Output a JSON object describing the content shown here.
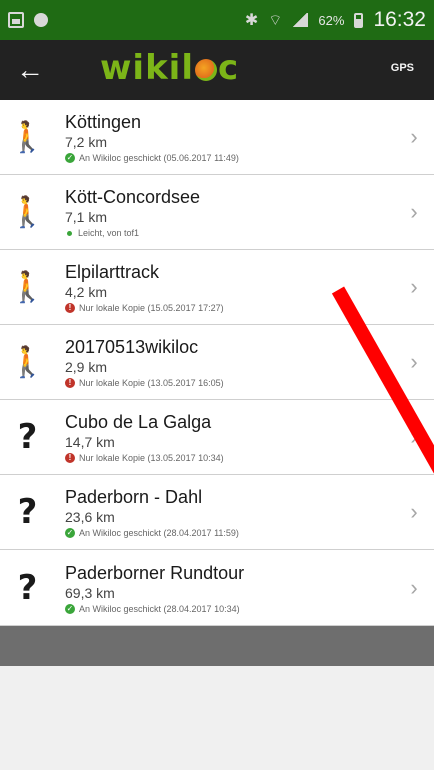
{
  "status_bar": {
    "time": "16:32",
    "battery": "62%"
  },
  "app_bar": {
    "logo": "wikiloc",
    "gps_label": "GPS"
  },
  "tracks": [
    {
      "title": "Köttingen",
      "distance": "7,2 km",
      "status": "An Wikiloc geschickt (05.06.2017 11:49)",
      "status_type": "sent",
      "icon": "hiker-icon"
    },
    {
      "title": "Kött-Concordsee",
      "distance": "7,1 km",
      "status": "Leicht, von tof1",
      "status_type": "info",
      "icon": "hiker-icon"
    },
    {
      "title": "Elpilarttrack",
      "distance": "4,2 km",
      "status": "Nur lokale Kopie (15.05.2017 17:27)",
      "status_type": "local",
      "icon": "hiker-icon"
    },
    {
      "title": "20170513wikiloc",
      "distance": "2,9 km",
      "status": "Nur lokale Kopie (13.05.2017 16:05)",
      "status_type": "local",
      "icon": "hiker-icon"
    },
    {
      "title": "Cubo de La Galga",
      "distance": "14,7 km",
      "status": "Nur lokale Kopie (13.05.2017 10:34)",
      "status_type": "local",
      "icon": "question-icon"
    },
    {
      "title": "Paderborn - Dahl",
      "distance": "23,6 km",
      "status": "An Wikiloc geschickt (28.04.2017 11:59)",
      "status_type": "sent",
      "icon": "question-icon"
    },
    {
      "title": "Paderborner Rundtour",
      "distance": "69,3 km",
      "status": "An Wikiloc geschickt (28.04.2017 10:34)",
      "status_type": "sent",
      "icon": "question-icon"
    }
  ],
  "colors": {
    "status_bar": "#1f6b14",
    "app_bar": "#222222",
    "logo": "#7cb518",
    "annotation": "#ff0000"
  }
}
